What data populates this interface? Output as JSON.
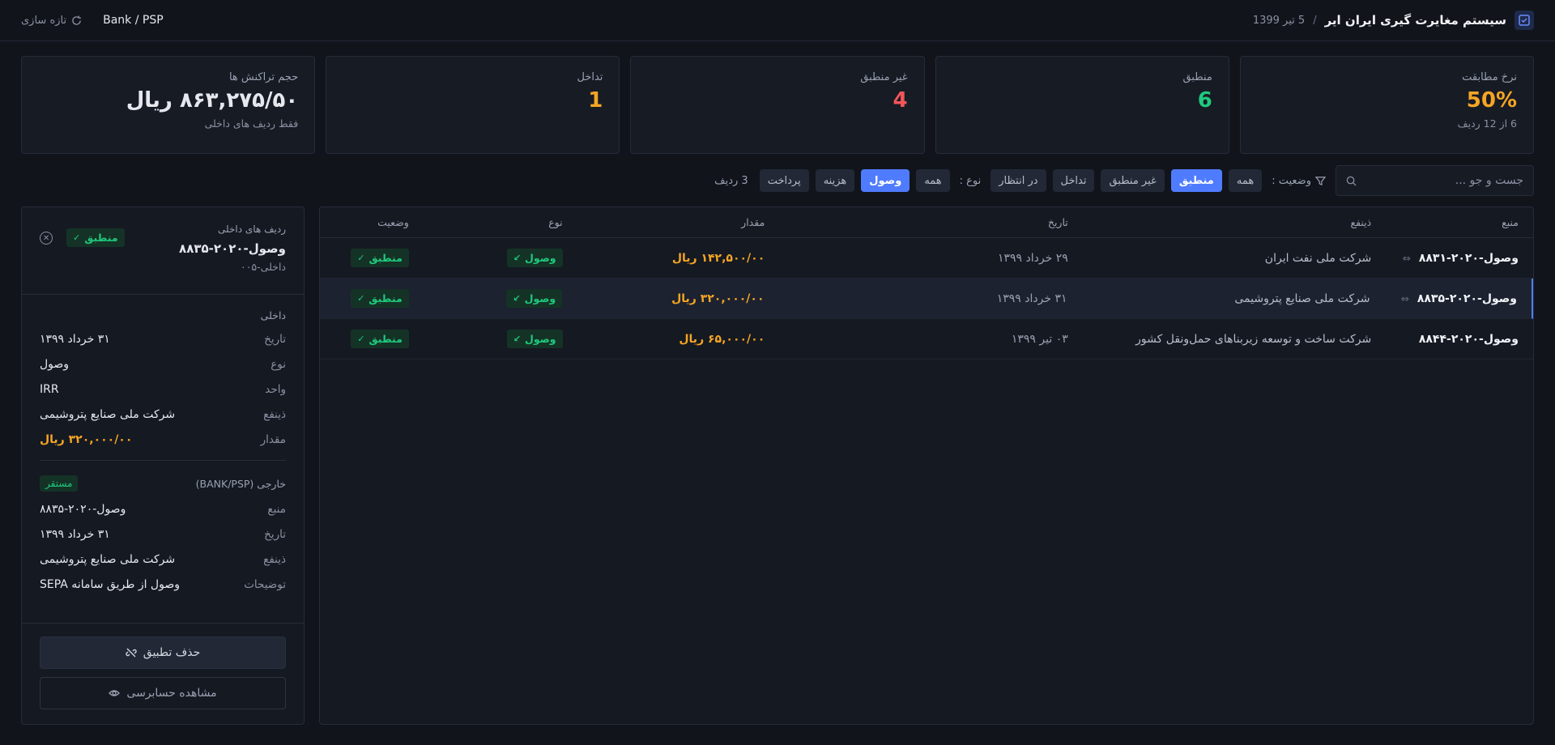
{
  "header": {
    "title": "سیستم مغایرت گیری ایران ایر",
    "separator": "/",
    "date": "5 تیر 1399",
    "brand_icon": "check-square-icon",
    "refresh_label": "تازه سازی",
    "source_label": "Bank / PSP"
  },
  "cards": [
    {
      "label": "نرخ مطابقت",
      "value": "50%",
      "sub": "6 از 12 ردیف",
      "color": "#f5a524"
    },
    {
      "label": "منطبق",
      "value": "6",
      "sub": "",
      "color": "#1fc97e"
    },
    {
      "label": "غیر منطبق",
      "value": "4",
      "sub": "",
      "color": "#f2555a"
    },
    {
      "label": "تداخل",
      "value": "1",
      "sub": "",
      "color": "#f5a524"
    },
    {
      "label": "حجم تراکنش ها",
      "value": "۸۶۳,۲۷۵/۵۰ ریال",
      "sub": "فقط ردیف های داخلی",
      "color": "#f1f3f7"
    }
  ],
  "filters": {
    "search_placeholder": "جست و جو ...",
    "status_label": "وضعیت :",
    "status_options": [
      "همه",
      "منطبق",
      "غیر منطبق",
      "تداخل",
      "در انتظار"
    ],
    "status_active": "منطبق",
    "type_label": "نوع :",
    "type_options": [
      "همه",
      "وصول",
      "هزینه",
      "پرداخت"
    ],
    "type_active": "وصول",
    "row_count": "3 ردیف"
  },
  "table": {
    "headers": {
      "source": "منبع",
      "beneficiary": "ذینفع",
      "date": "تاریخ",
      "amount": "مقدار",
      "type": "نوع",
      "status": "وضعیت"
    },
    "rows": [
      {
        "source": "وصول-۲۰۲۰-۸۸۳۱",
        "beneficiary": "شرکت ملی نفت ایران",
        "date": "۲۹ خرداد ۱۳۹۹",
        "amount": "۱۴۲,۵۰۰/۰۰ ریال",
        "type": "وصول",
        "status": "منطبق",
        "linked": true
      },
      {
        "source": "وصول-۲۰۲۰-۸۸۳۵",
        "beneficiary": "شرکت ملی صنایع پتروشیمی",
        "date": "۳۱ خرداد ۱۳۹۹",
        "amount": "۳۲۰,۰۰۰/۰۰ ریال",
        "type": "وصول",
        "status": "منطبق",
        "linked": true,
        "selected": true
      },
      {
        "source": "وصول-۲۰۲۰-۸۸۴۴",
        "beneficiary": "شرکت ساخت و توسعه زیربناهای حمل‌ونقل کشور",
        "date": "۰۳ تیر ۱۳۹۹",
        "amount": "۶۵,۰۰۰/۰۰ ریال",
        "type": "وصول",
        "status": "منطبق",
        "linked": false
      }
    ]
  },
  "detail": {
    "section_label": "ردیف های داخلی",
    "id": "وصول-۲۰۲۰-۸۸۳۵",
    "sub": "داخلی-۰۰۵",
    "status": "منطبق",
    "internal_title": "داخلی",
    "internal": [
      {
        "k": "تاریخ",
        "v": "۳۱ خرداد ۱۳۹۹"
      },
      {
        "k": "نوع",
        "v": "وصول"
      },
      {
        "k": "واحد",
        "v": "IRR"
      },
      {
        "k": "ذینفع",
        "v": "شرکت ملی صنایع پتروشیمی"
      },
      {
        "k": "مقدار",
        "v": "۳۲۰,۰۰۰/۰۰ ریال"
      }
    ],
    "external_title": "خارجی (BANK/PSP)",
    "external_badge": "مستقر",
    "external": [
      {
        "k": "منبع",
        "v": "وصول-۲۰۲۰-۸۸۳۵"
      },
      {
        "k": "تاریخ",
        "v": "۳۱ خرداد ۱۳۹۹"
      },
      {
        "k": "ذینفع",
        "v": "شرکت ملی صنایع پتروشیمی"
      },
      {
        "k": "توضیحات",
        "v": "وصول از طریق سامانه SEPA"
      }
    ],
    "remove_label": "حذف تطبیق",
    "audit_label": "مشاهده حسابرسی"
  }
}
